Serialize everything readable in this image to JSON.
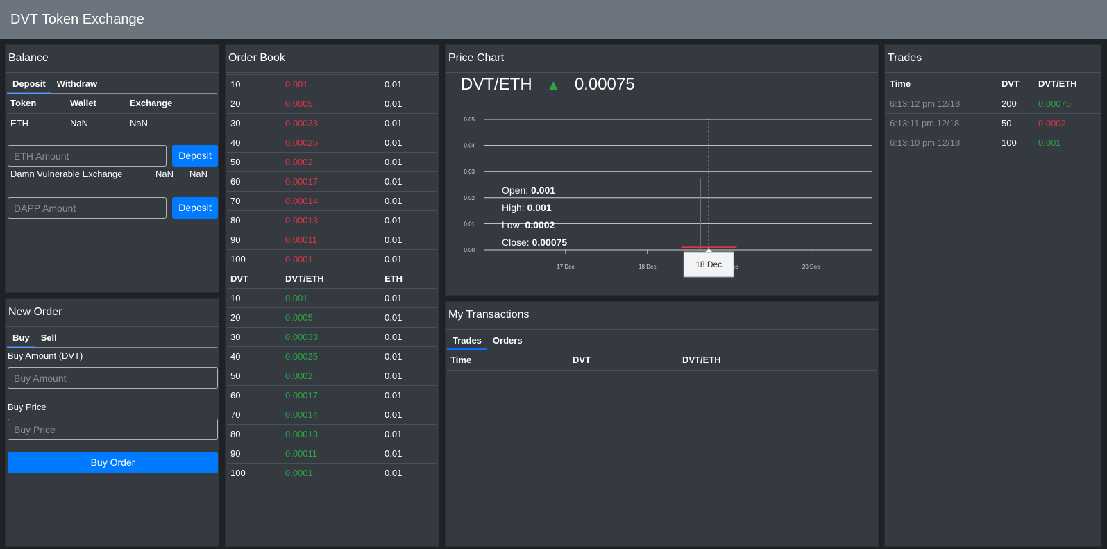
{
  "app": {
    "title": "DVT Token Exchange"
  },
  "balance": {
    "title": "Balance",
    "tabs": [
      "Deposit",
      "Withdraw"
    ],
    "headers": [
      "Token",
      "Wallet",
      "Exchange"
    ],
    "eth_row": {
      "token": "ETH",
      "wallet": "NaN",
      "exchange": "NaN"
    },
    "eth_placeholder": "ETH Amount",
    "deposit_label": "Deposit",
    "dapp_row": {
      "token": "Damn Vulnerable Exchange",
      "wallet": "NaN",
      "exchange": "NaN"
    },
    "dapp_placeholder": "DAPP Amount",
    "deposit_label_2": "Deposit"
  },
  "new_order": {
    "title": "New Order",
    "tabs": [
      "Buy",
      "Sell"
    ],
    "amount_label": "Buy Amount (DVT)",
    "amount_placeholder": "Buy Amount",
    "price_label": "Buy Price",
    "price_placeholder": "Buy Price",
    "submit_label": "Buy Order"
  },
  "order_book": {
    "title": "Order Book",
    "headers": [
      "DVT",
      "DVT/ETH",
      "ETH"
    ],
    "sell_orders": [
      [
        "10",
        "0.001",
        "0.01"
      ],
      [
        "20",
        "0.0005",
        "0.01"
      ],
      [
        "30",
        "0.00033",
        "0.01"
      ],
      [
        "40",
        "0.00025",
        "0.01"
      ],
      [
        "50",
        "0.0002",
        "0.01"
      ],
      [
        "60",
        "0.00017",
        "0.01"
      ],
      [
        "70",
        "0.00014",
        "0.01"
      ],
      [
        "80",
        "0.00013",
        "0.01"
      ],
      [
        "90",
        "0.00011",
        "0.01"
      ],
      [
        "100",
        "0.0001",
        "0.01"
      ]
    ],
    "buy_orders": [
      [
        "10",
        "0.001",
        "0.01"
      ],
      [
        "20",
        "0.0005",
        "0.01"
      ],
      [
        "30",
        "0.00033",
        "0.01"
      ],
      [
        "40",
        "0.00025",
        "0.01"
      ],
      [
        "50",
        "0.0002",
        "0.01"
      ],
      [
        "60",
        "0.00017",
        "0.01"
      ],
      [
        "70",
        "0.00014",
        "0.01"
      ],
      [
        "80",
        "0.00013",
        "0.01"
      ],
      [
        "90",
        "0.00011",
        "0.01"
      ],
      [
        "100",
        "0.0001",
        "0.01"
      ]
    ]
  },
  "price_chart": {
    "title": "Price Chart",
    "pair": "DVT/ETH",
    "arrow_icon": "arrow-up-icon",
    "price": "0.00075",
    "tooltip": {
      "open_label": "Open:",
      "open": "0.001",
      "high_label": "High:",
      "high": "0.001",
      "low_label": "Low:",
      "low": "0.0002",
      "close_label": "Close:",
      "close": "0.00075"
    },
    "crosshair_label": "18 Dec",
    "colors": {
      "down": "#dc3545",
      "up": "#28a745"
    }
  },
  "chart_data": {
    "type": "candlestick",
    "y_ticks": [
      "0.00",
      "0.01",
      "0.02",
      "0.03",
      "0.04",
      "0.05"
    ],
    "ylim": [
      0,
      0.05
    ],
    "x_ticks": [
      "17 Dec",
      "18 Dec",
      "19 Dec",
      "20 Dec"
    ],
    "x_tick_days": [
      17,
      18,
      19,
      20
    ],
    "xlim_days": [
      16.0,
      20.75
    ],
    "candles": [
      {
        "day": 18.65,
        "open": 0.001,
        "high": 0.001,
        "low": 0.0002,
        "close": 0.00075
      }
    ],
    "crosshair_day": 18.75
  },
  "my_transactions": {
    "title": "My Transactions",
    "tabs": [
      "Trades",
      "Orders"
    ],
    "headers": [
      "Time",
      "DVT",
      "DVT/ETH"
    ]
  },
  "trades": {
    "title": "Trades",
    "headers": [
      "Time",
      "DVT",
      "DVT/ETH"
    ],
    "rows": [
      {
        "time": "6:13:12 pm 12/18",
        "dvt": "200",
        "price": "0.00075",
        "dir": "up"
      },
      {
        "time": "6:13:11 pm 12/18",
        "dvt": "50",
        "price": "0.0002",
        "dir": "down"
      },
      {
        "time": "6:13:10 pm 12/18",
        "dvt": "100",
        "price": "0.001",
        "dir": "up"
      }
    ]
  }
}
